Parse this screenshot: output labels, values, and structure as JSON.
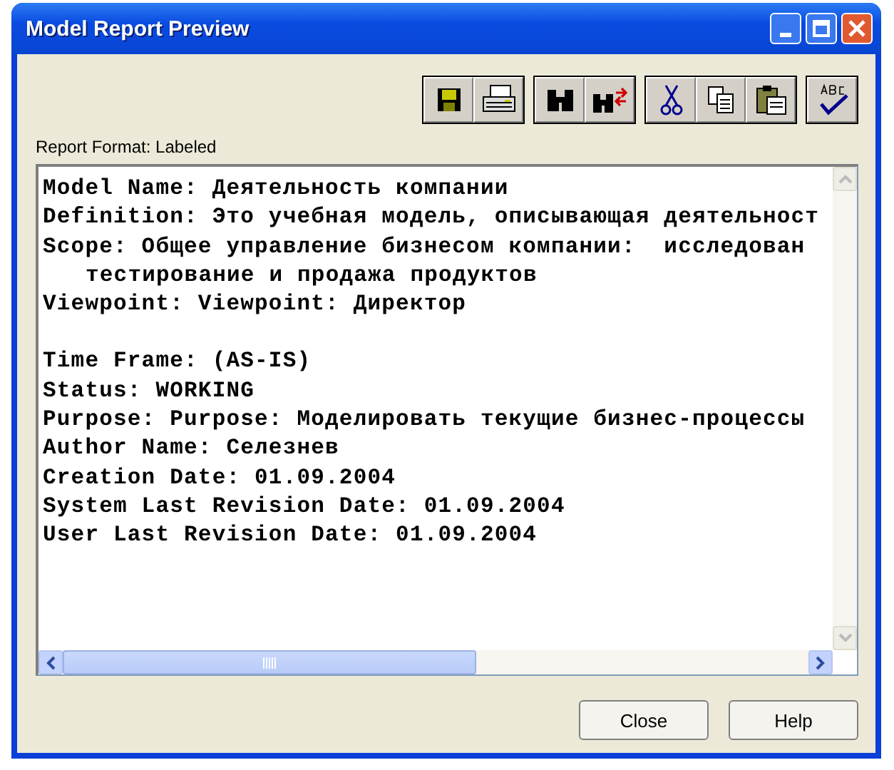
{
  "window": {
    "title": "Model Report Preview"
  },
  "toolbar": {
    "groups": [
      [
        {
          "kind": "save"
        },
        {
          "kind": "print"
        }
      ],
      [
        {
          "kind": "find"
        },
        {
          "kind": "replace"
        }
      ],
      [
        {
          "kind": "cut"
        },
        {
          "kind": "copy"
        },
        {
          "kind": "paste"
        }
      ],
      [
        {
          "kind": "spell"
        }
      ]
    ]
  },
  "report_format_label": "Report Format: Labeled",
  "report": {
    "paragraphs": [
      [
        {
          "kind": "line",
          "text": "Model Name: Деятельность компании"
        },
        {
          "kind": "line",
          "text": "Definition: Это учебная модель, описывающая деятельност"
        },
        {
          "kind": "line",
          "text": "Scope: Общее управление бизнесом компании:  исследован"
        },
        {
          "kind": "continuation",
          "text": "тестирование и продажа продуктов"
        },
        {
          "kind": "line",
          "text": "Viewpoint: Viewpoint: Директор"
        }
      ],
      [
        {
          "kind": "line",
          "text": "Time Frame: (AS-IS)"
        },
        {
          "kind": "line",
          "text": "Status: WORKING"
        },
        {
          "kind": "line",
          "text": "Purpose: Purpose: Моделировать текущие бизнес-процессы"
        },
        {
          "kind": "line",
          "text": "Author Name: Селезнев"
        },
        {
          "kind": "line",
          "text": "Creation Date: 01.09.2004"
        },
        {
          "kind": "line",
          "text": "System Last Revision Date: 01.09.2004"
        },
        {
          "kind": "line",
          "text": "User Last Revision Date: 01.09.2004"
        }
      ]
    ]
  },
  "buttons": [
    "Close",
    "Help"
  ]
}
